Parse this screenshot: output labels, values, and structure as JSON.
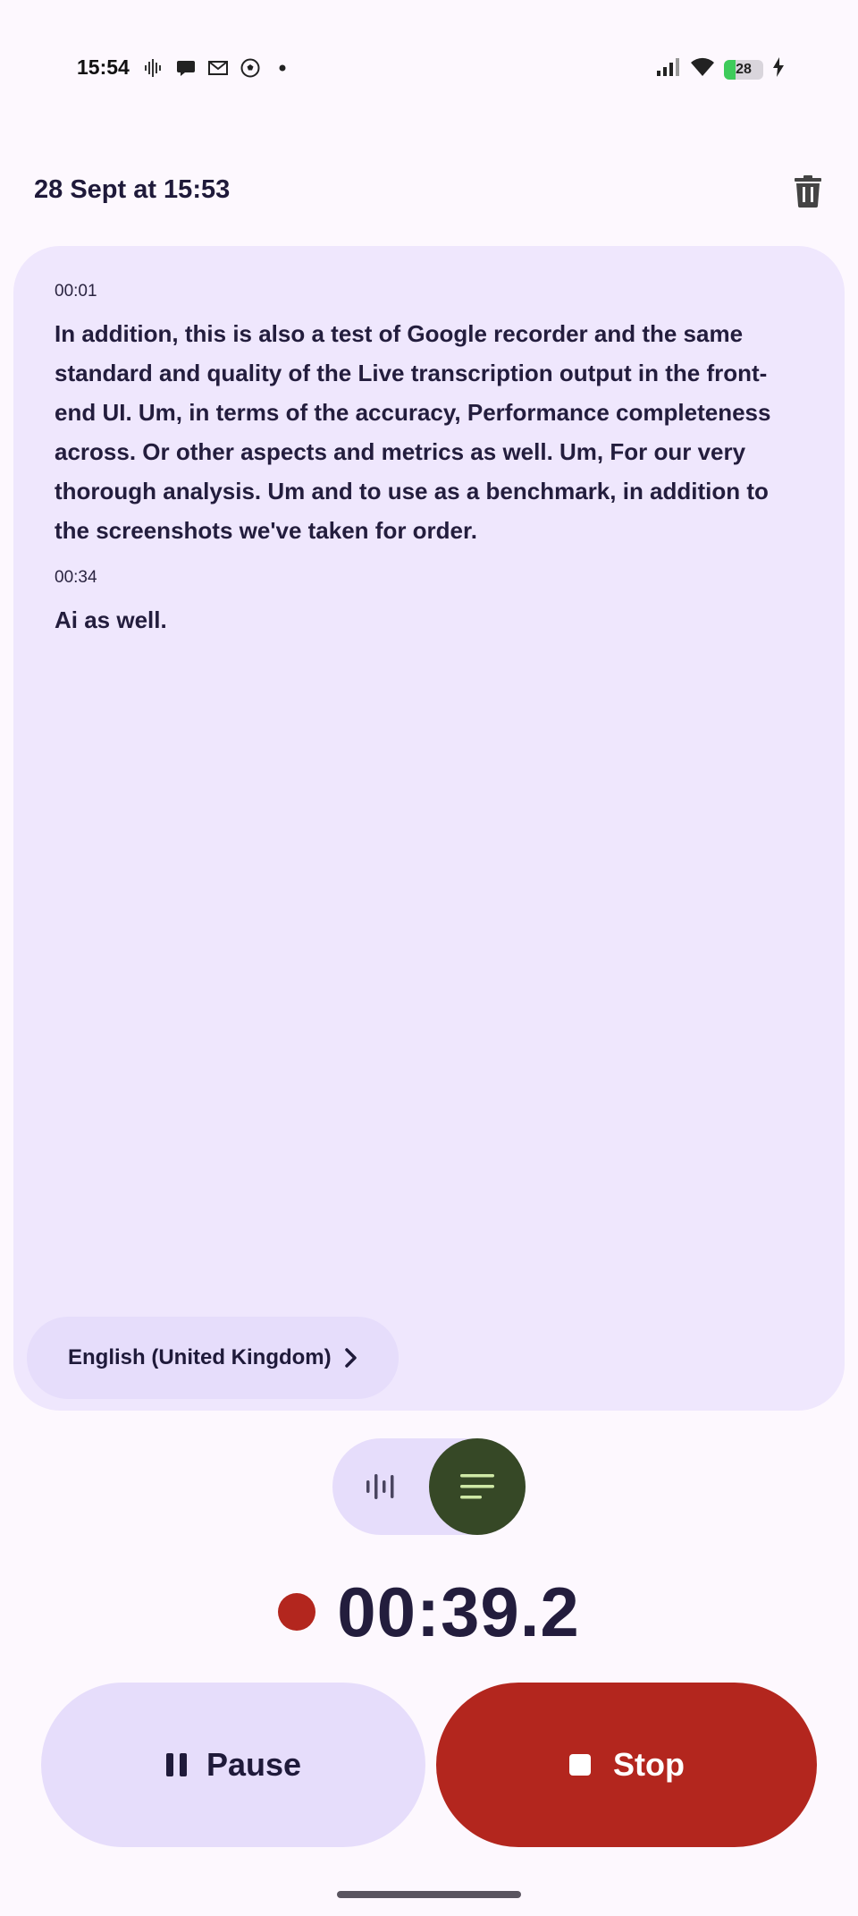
{
  "status_bar": {
    "time": "15:54",
    "left_icons": [
      "soundwave-icon",
      "chat-bubble-icon",
      "gmail-icon",
      "football-icon",
      "dot-icon"
    ],
    "right_icons": [
      "signal-icon",
      "wifi-icon",
      "battery-icon",
      "charging-icon"
    ],
    "battery_level": "28",
    "battery_color": "#3ecb5b"
  },
  "header": {
    "title": "28 Sept at 15:53",
    "delete_icon": "trash-icon"
  },
  "transcript": {
    "segments": [
      {
        "time": "00:01",
        "text": "In addition, this is also a test of Google recorder and the same standard and quality of the Live transcription output in the front-end UI. Um, in terms of the accuracy, Performance completeness across. Or other aspects and metrics as well. Um, For our very thorough analysis. Um and to use as a benchmark, in addition to the screenshots we've taken for order."
      },
      {
        "time": "00:34",
        "text": "Ai as well."
      }
    ],
    "language": "English (United Kingdom)"
  },
  "view_toggle": {
    "options": [
      "waveform-icon",
      "transcript-icon"
    ],
    "selected": "transcript-icon"
  },
  "recording": {
    "elapsed": "00:39.2",
    "indicator_color": "#b3261e"
  },
  "controls": {
    "pause_label": "Pause",
    "stop_label": "Stop"
  },
  "colors": {
    "background": "#fdf8fe",
    "card": "#efe7fd",
    "chip": "#e6ddfb",
    "accent_dark_green": "#364826",
    "stop_red": "#b3261e"
  }
}
